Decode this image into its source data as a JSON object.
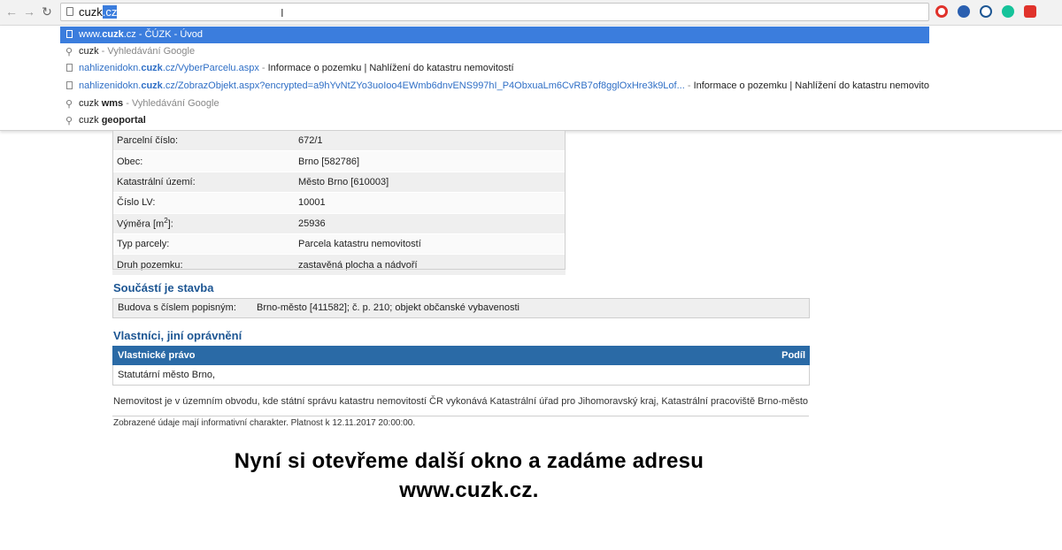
{
  "browser": {
    "address": {
      "typed": "cuzk",
      "autocomplete": ".cz"
    },
    "extensions": [
      {
        "name": "opera-icon",
        "color": "#e0322b"
      },
      {
        "name": "extension-icon",
        "color": "#2a5fb0"
      },
      {
        "name": "play-icon",
        "color": "#1d5693"
      },
      {
        "name": "grammarly-icon",
        "color": "#15c39a"
      },
      {
        "name": "media-icon",
        "color": "#e0322b"
      }
    ]
  },
  "suggestions": [
    {
      "type": "url",
      "url_pre": "www.",
      "url_bold": "cuzk",
      "url_post": ".cz",
      "sep": " - ",
      "title": "ČÚZK - Úvod"
    },
    {
      "type": "search",
      "query": "cuzk",
      "bold": "",
      "sep": " - ",
      "title": "Vyhledávání Google"
    },
    {
      "type": "url",
      "url_pre": "nahlizenidokn.",
      "url_bold": "cuzk",
      "url_post": ".cz/VyberParcelu.aspx",
      "sep": " - ",
      "title": "Informace o pozemku | Nahlížení do katastru nemovitostí"
    },
    {
      "type": "url",
      "url_pre": "nahlizenidokn.",
      "url_bold": "cuzk",
      "url_post": ".cz/ZobrazObjekt.aspx?encrypted=a9hYvNtZYo3uoIoo4EWmb6dnvENS997hI_P4ObxuaLm6CvRB7of8gglOxHre3k9Lof...",
      "sep": " - ",
      "title": "Informace o pozemku | Nahlížení do katastru nemovitostí"
    },
    {
      "type": "search",
      "query": "cuzk ",
      "bold": "wms",
      "sep": " - ",
      "title": "Vyhledávání Google"
    },
    {
      "type": "search",
      "query": "cuzk ",
      "bold": "geoportal",
      "sep": "",
      "title": ""
    }
  ],
  "parcel": {
    "rows": [
      {
        "key": "Parcelní číslo:",
        "value": "672/1"
      },
      {
        "key": "Obec:",
        "value": "Brno [582786]"
      },
      {
        "key": "Katastrální území:",
        "value": "Město Brno [610003]"
      },
      {
        "key": "Číslo LV:",
        "value": "10001"
      },
      {
        "key": "Výměra [m",
        "key_sup": "2",
        "key_post": "]:",
        "value": "25936"
      },
      {
        "key": "Typ parcely:",
        "value": "Parcela katastru nemovitostí"
      },
      {
        "key": "Druh pozemku:",
        "value": "zastavěná plocha a nádvoří"
      }
    ]
  },
  "stavba": {
    "title": "Součástí je stavba",
    "key": "Budova s číslem popisným:",
    "value": "Brno-město [411582]; č. p. 210; objekt občanské vybavenosti"
  },
  "owners": {
    "title": "Vlastníci, jiní oprávnění",
    "col_left": "Vlastnické právo",
    "col_right": "Podíl",
    "row": "Statutární město Brno,"
  },
  "note": "Nemovitost je v územním obvodu, kde státní správu katastru nemovitostí ČR vykonává Katastrální úřad pro Jihomoravský kraj, Katastrální pracoviště Brno-město",
  "validity": "Zobrazené údaje mají informativní charakter. Platnost k 12.11.2017 20:00:00.",
  "subtitle": {
    "line1": "Nyní si otevřeme další okno a zadáme adresu",
    "line2": "www.cuzk.cz."
  }
}
